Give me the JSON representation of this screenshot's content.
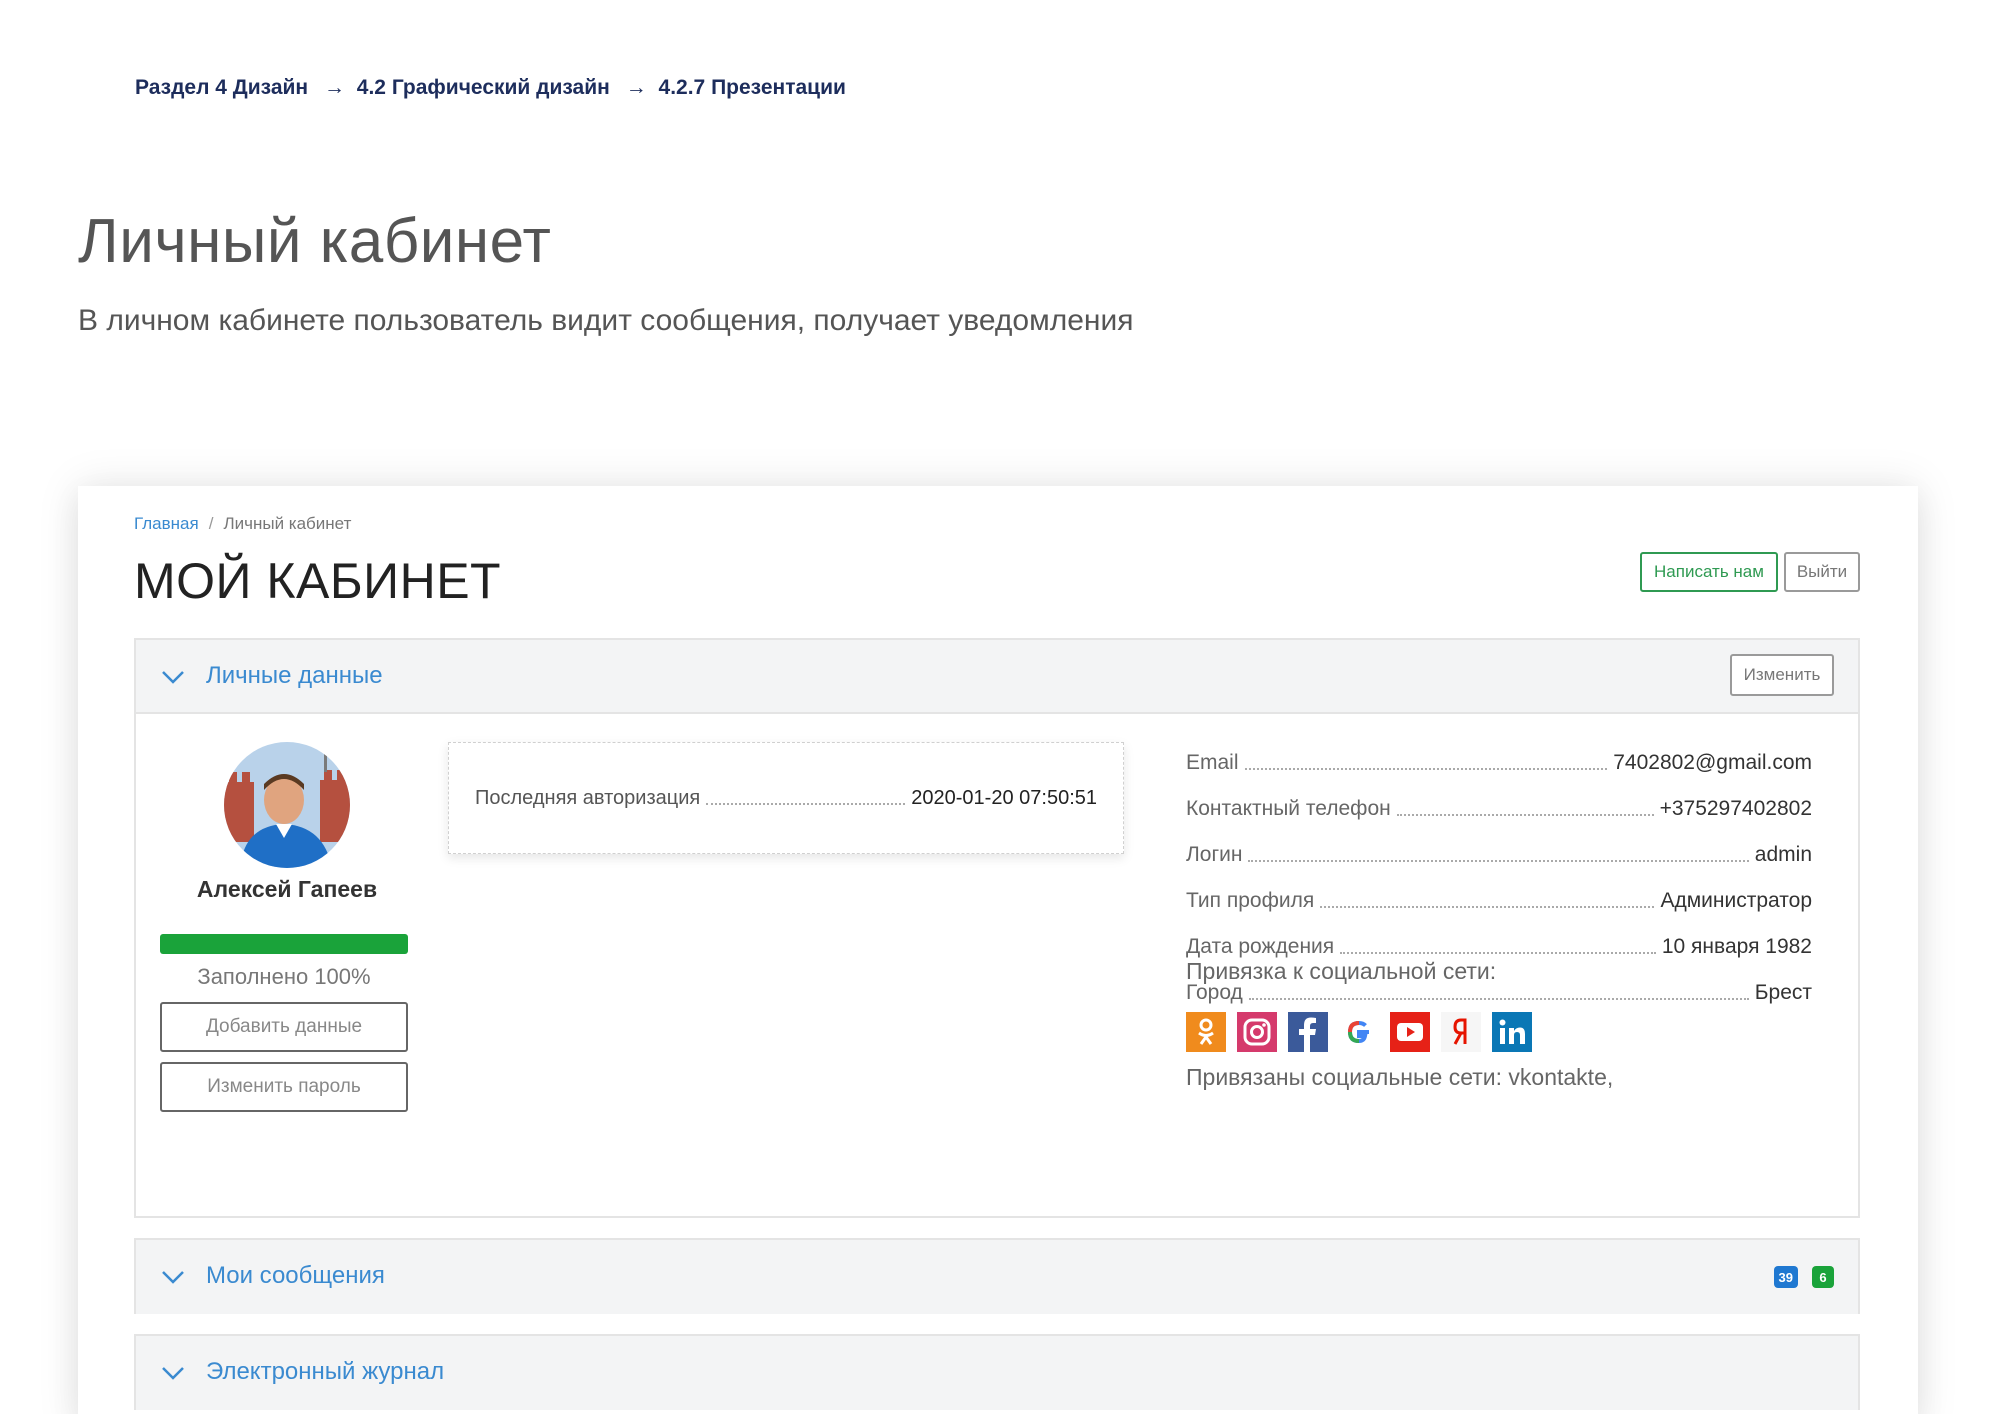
{
  "doc": {
    "breadcrumb": [
      "Раздел 4 Дизайн",
      "4.2 Графический дизайн",
      "4.2.7 Презентации"
    ],
    "breadcrumb_sep": "→",
    "title": "Личный кабинет",
    "subtitle": "В личном кабинете пользователь видит сообщения, получает уведомления"
  },
  "app": {
    "crumb": {
      "home": "Главная",
      "sep": "/",
      "current": "Личный кабинет"
    },
    "title": "МОЙ КАБИНЕТ",
    "write_label": "Написать нам",
    "exit_label": "Выйти",
    "personal": {
      "title": "Личные данные",
      "edit_label": "Изменить",
      "user_name": "Алексей Гапеев",
      "progress": 1.0,
      "filled_text": "Заполнено 100%",
      "add_label": "Добавить данные",
      "password_label": "Изменить пароль",
      "last_auth_label": "Последняя авторизация",
      "last_auth_value": "2020-01-20 07:50:51",
      "fields": [
        {
          "label": "Email",
          "value": "7402802@gmail.com"
        },
        {
          "label": "Контактный телефон",
          "value": "+375297402802"
        },
        {
          "label": "Логин",
          "value": "admin"
        },
        {
          "label": "Тип профиля",
          "value": "Администратор"
        },
        {
          "label": "Дата рождения",
          "value": "10 января 1982"
        },
        {
          "label": "Город",
          "value": "Брест"
        }
      ],
      "social_title": "Привязка к социальной сети:",
      "social_icons": [
        "odnoklassniki-icon",
        "instagram-icon",
        "facebook-icon",
        "google-icon",
        "youtube-icon",
        "yandex-icon",
        "linkedin-icon"
      ],
      "linked_text": "Привязаны социальные сети: vkontakte,"
    },
    "messages": {
      "title": "Мои сообщения",
      "badge_blue": "39",
      "badge_green": "6"
    },
    "journal": {
      "title": "Электронный журнал"
    },
    "colors": {
      "accent_blue": "#3a8ad0",
      "green": "#1aa33a",
      "badge_blue": "#1f78d1",
      "badge_green": "#1aa33a"
    }
  }
}
